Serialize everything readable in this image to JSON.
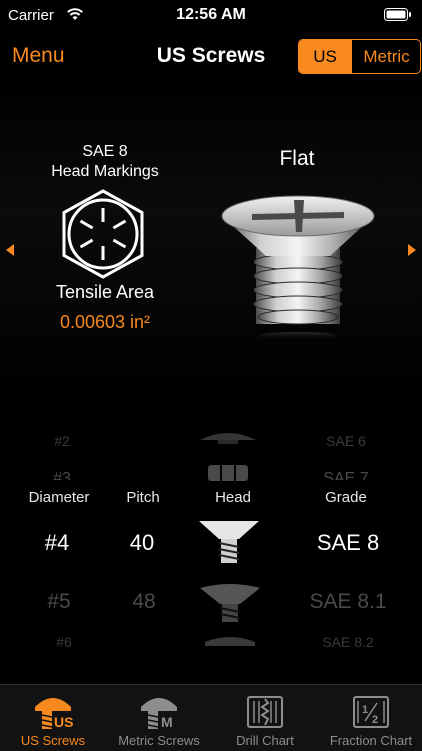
{
  "status_bar": {
    "carrier": "Carrier",
    "time": "12:56 AM"
  },
  "nav": {
    "menu": "Menu",
    "title": "US Screws",
    "unit_options": [
      "US",
      "Metric"
    ],
    "selected_unit": "US"
  },
  "detail": {
    "grade": "SAE 8",
    "head_markings_label": "Head Markings",
    "tensile_label": "Tensile Area",
    "tensile_value": "0.00603 in²",
    "head_type": "Flat"
  },
  "picker": {
    "columns": [
      "Diameter",
      "Pitch",
      "Head",
      "Grade"
    ],
    "diameter": {
      "above2": "#2",
      "above1": "#3",
      "selected": "#4",
      "below1": "#5",
      "below2": "#6"
    },
    "pitch": {
      "selected": "40",
      "below1": "48"
    },
    "grade": {
      "above2": "SAE 6",
      "above1": "SAE 7",
      "selected": "SAE 8",
      "below1": "SAE 8.1",
      "below2": "SAE 8.2"
    }
  },
  "tabs": [
    {
      "label": "US Screws",
      "icon": "us-screw-icon",
      "active": true
    },
    {
      "label": "Metric Screws",
      "icon": "metric-screw-icon",
      "active": false
    },
    {
      "label": "Drill Chart",
      "icon": "drill-chart-icon",
      "active": false
    },
    {
      "label": "Fraction Chart",
      "icon": "fraction-chart-icon",
      "active": false
    }
  ],
  "colors": {
    "accent": "#f7891f",
    "background": "#000000",
    "tabbar": "#121212"
  }
}
